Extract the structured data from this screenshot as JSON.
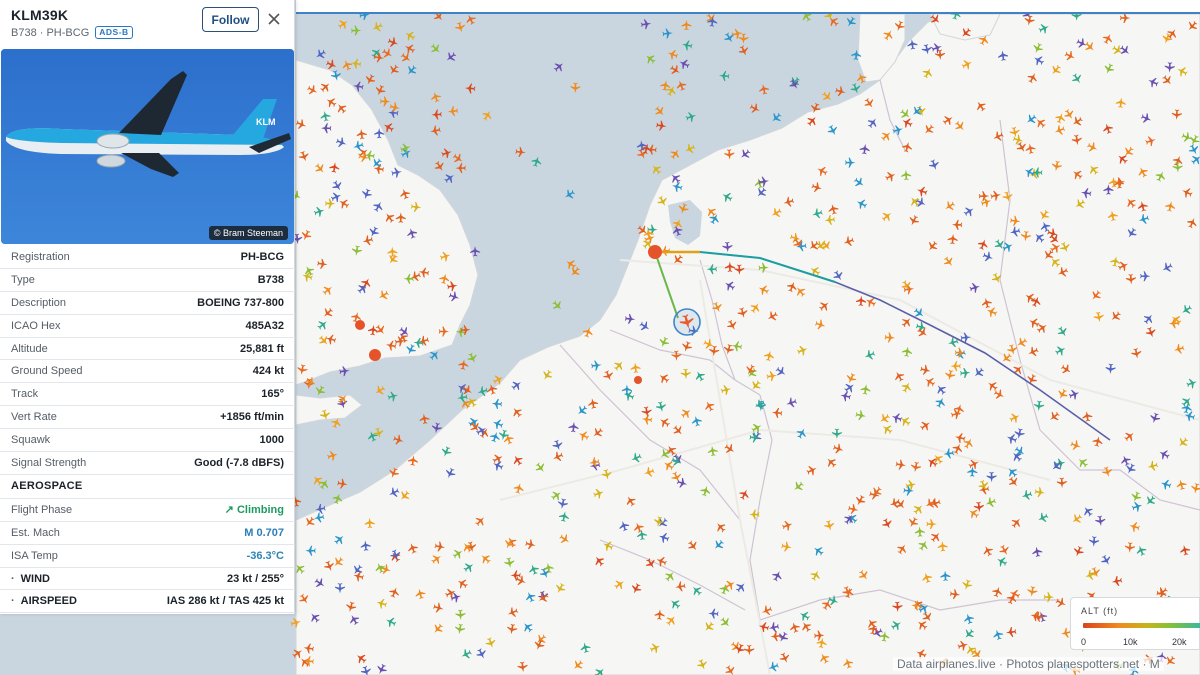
{
  "flight": {
    "callsign": "KLM39K",
    "subtitle": "B738 · PH-BCG",
    "source_badge": "ADS-B",
    "follow_label": "Follow",
    "photo_credit": "© Bram Steeman"
  },
  "details": [
    {
      "label": "Registration",
      "value": "PH-BCG"
    },
    {
      "label": "Type",
      "value": "B738"
    },
    {
      "label": "Description",
      "value": "BOEING 737-800"
    },
    {
      "label": "ICAO Hex",
      "value": "485A32"
    },
    {
      "label": "Altitude",
      "value": "25,881 ft"
    },
    {
      "label": "Ground Speed",
      "value": "424 kt"
    },
    {
      "label": "Track",
      "value": "165°"
    },
    {
      "label": "Vert Rate",
      "value": "+1856 ft/min"
    },
    {
      "label": "Squawk",
      "value": "1000"
    },
    {
      "label": "Signal Strength",
      "value": "Good (-7.8 dBFS)"
    }
  ],
  "aerospace": {
    "title": "AEROSPACE",
    "rows": [
      {
        "label": "Flight Phase",
        "value": "↗ Climbing"
      },
      {
        "label": "Est. Mach",
        "value": "M 0.707"
      },
      {
        "label": "ISA Temp",
        "value": "-36.3°C"
      },
      {
        "label": "WIND",
        "value": "23 kt / 255°"
      },
      {
        "label": "AIRSPEED",
        "value": "IAS 286 kt / TAS 425 kt"
      }
    ]
  },
  "legend": {
    "title": "ALT (ft)",
    "ticks": [
      "0",
      "10k",
      "20k"
    ]
  },
  "attribution": "Data airplanes.live · Photos planespotters.net · M",
  "colors": {
    "accent": "#2878c3",
    "climbing": "#1f9a63",
    "track_line": "#5b5fa8",
    "water": "#c9d6e0",
    "land": "#f6f6f4"
  },
  "icons": [
    "close-icon",
    "airplane-icon",
    "trend-up-icon"
  ]
}
